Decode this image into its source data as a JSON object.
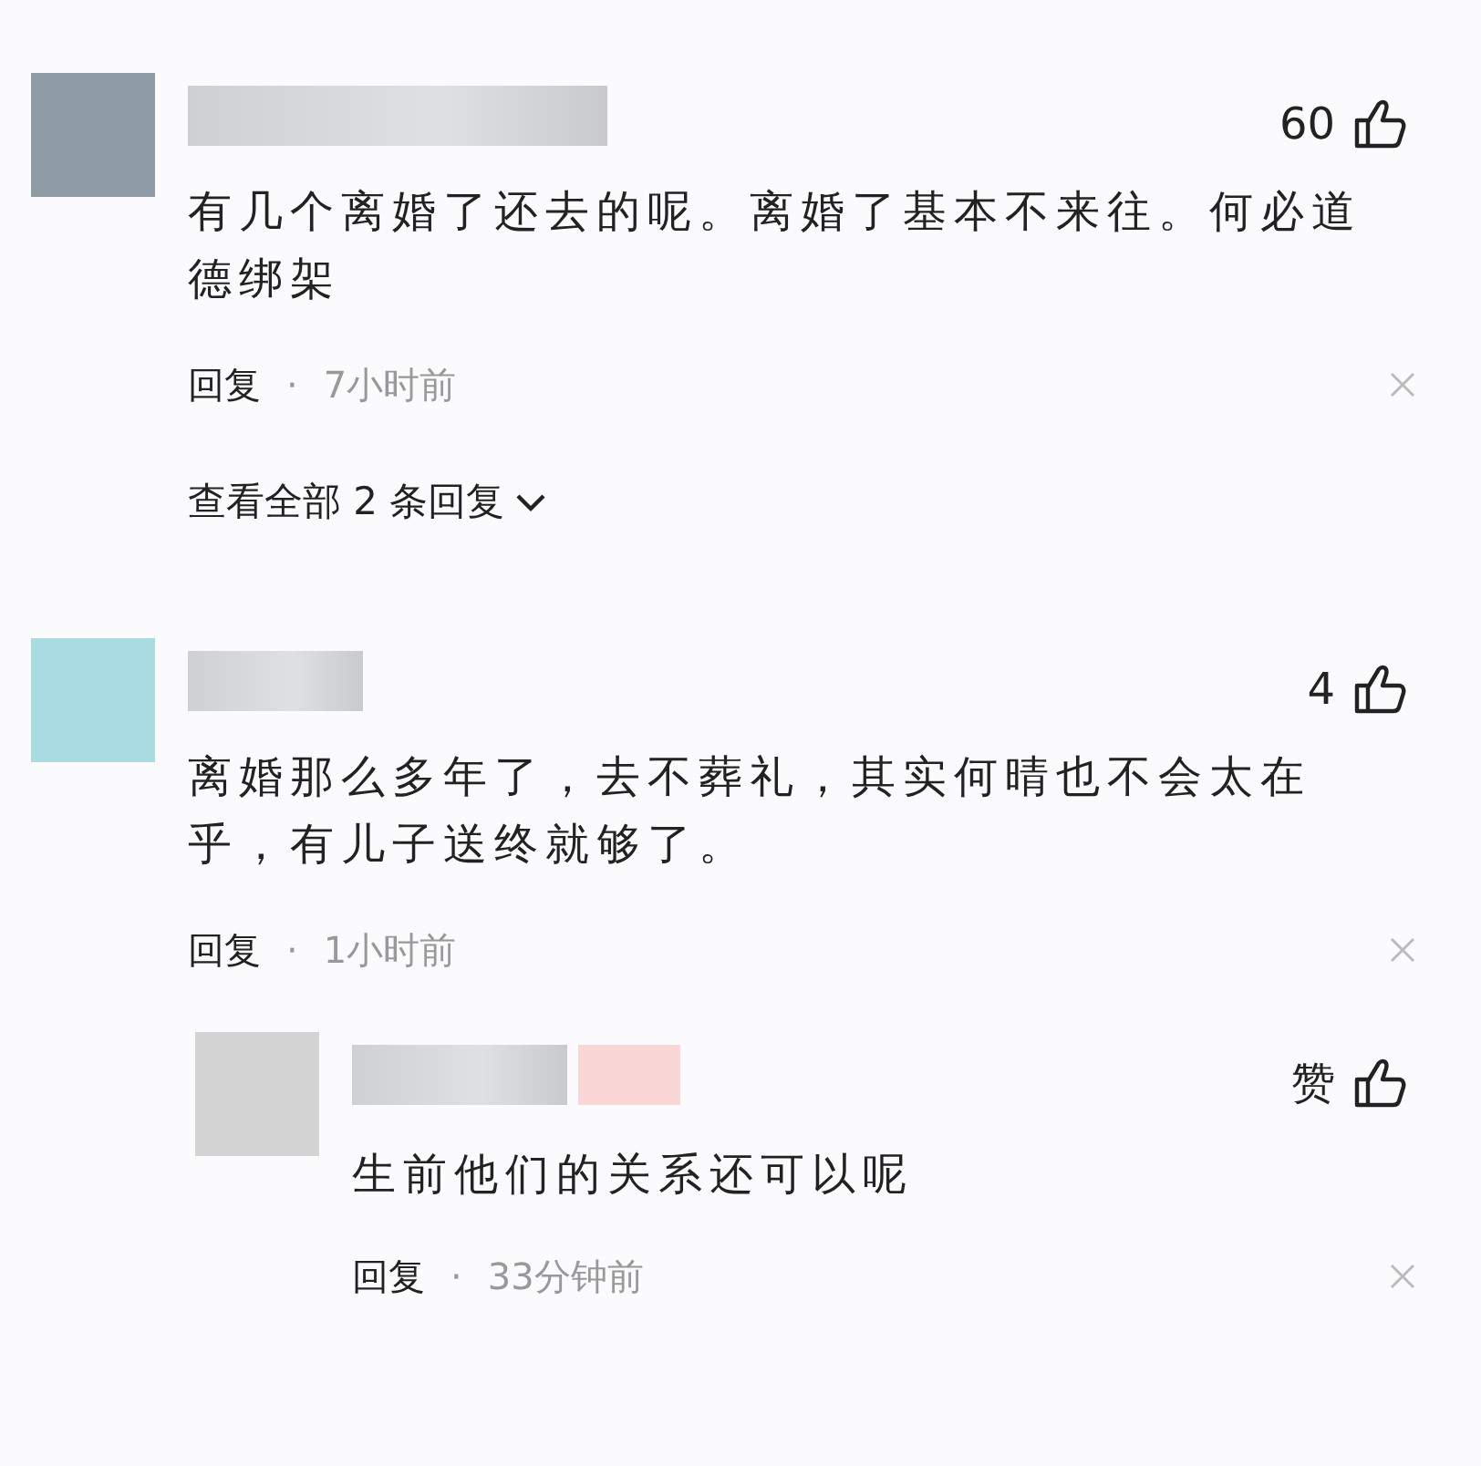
{
  "comments": [
    {
      "color": "#8f9ba5",
      "likes": "60",
      "text": "有几个离婚了还去的呢。离婚了基本不来往。何必道德绑架",
      "reply_label": "回复",
      "separator": "·",
      "time": "7小时前",
      "badge": false,
      "more_replies": "查看全部 2 条回复"
    },
    {
      "color": "#a9dce2",
      "likes": "4",
      "text": "离婚那么多年了，去不葬礼，其实何晴也不会太在乎，有儿子送终就够了。",
      "reply_label": "回复",
      "separator": "·",
      "time": "1小时前",
      "badge": false,
      "replies": [
        {
          "color": "#d4d3d4",
          "likes": "赞",
          "text": "生前他们的关系还可以呢",
          "reply_label": "回复",
          "separator": "·",
          "time": "33分钟前",
          "badge": true
        }
      ]
    }
  ]
}
